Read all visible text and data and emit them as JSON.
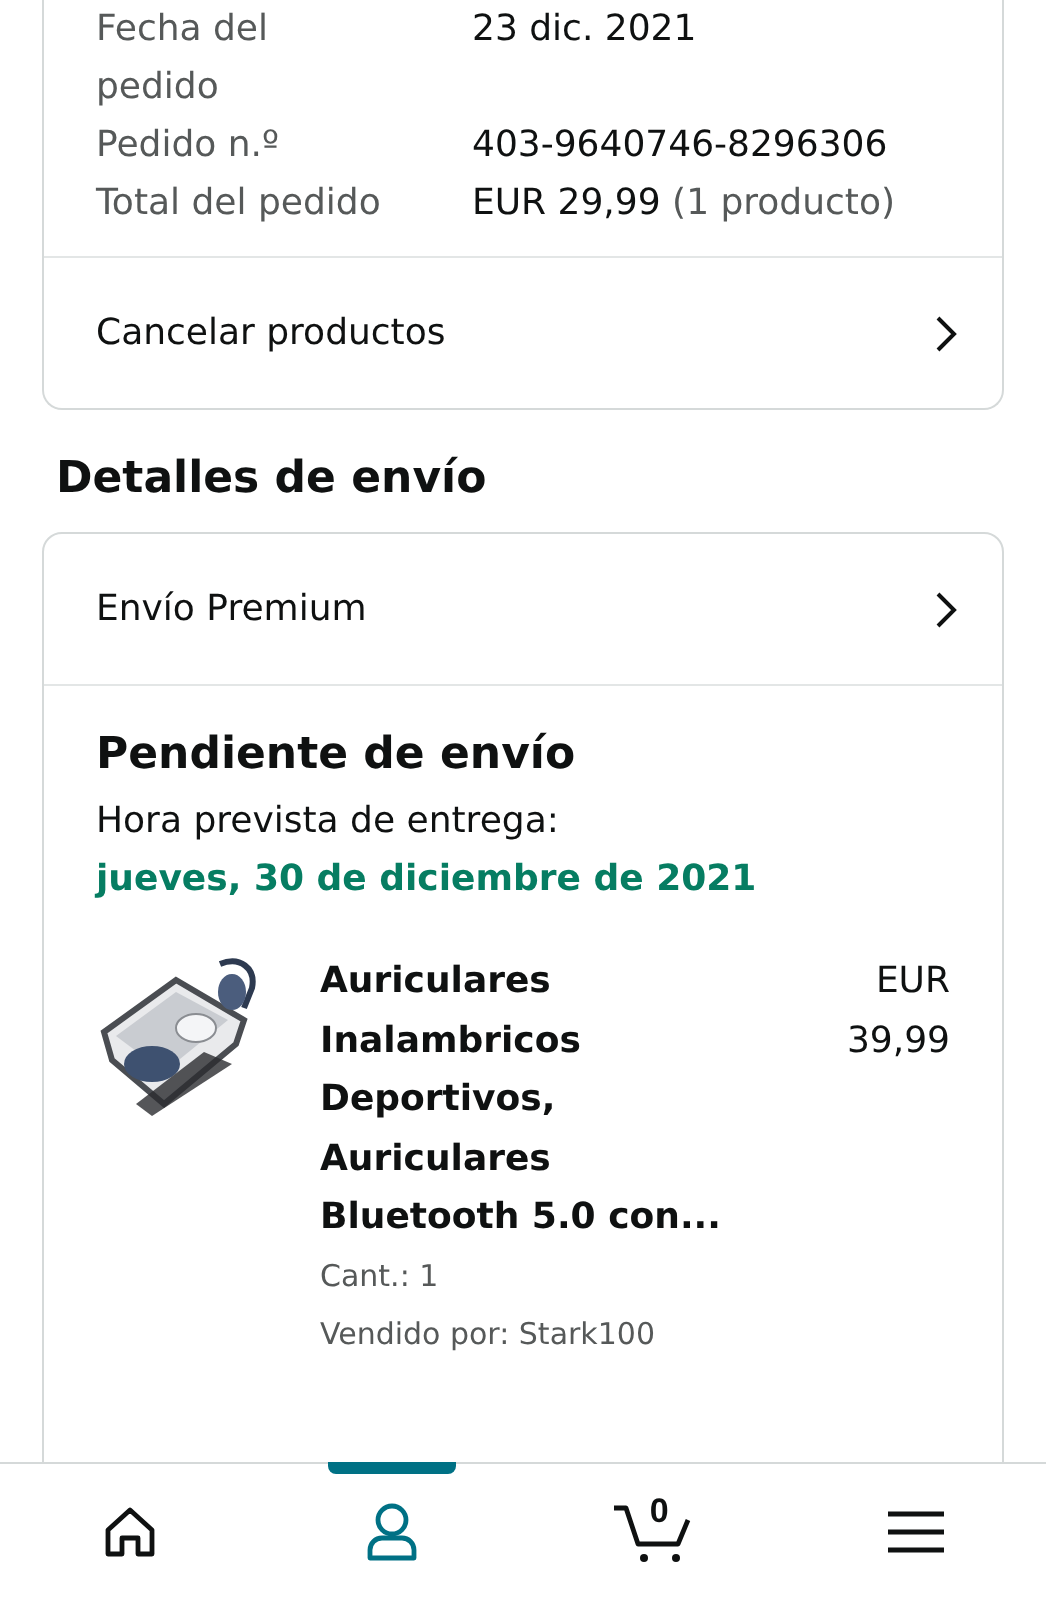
{
  "order_summary": {
    "rows": [
      {
        "label": "Fecha del pedido",
        "value": "23 dic. 2021"
      },
      {
        "label": "Pedido n.º",
        "value": "403-9640746-8296306"
      },
      {
        "label": "Total del pedido",
        "value": "EUR 29,99",
        "note": "(1 producto)"
      }
    ],
    "action": "Cancelar productos"
  },
  "shipping": {
    "heading": "Detalles de envío",
    "method": "Envío Premium",
    "status": "Pendiente de envío",
    "eta_label": "Hora prevista de entrega:",
    "eta": "jueves, 30 de diciembre de 2021",
    "item": {
      "kind": "picture",
      "title": "Auriculares Inalambricos Deportivos, Auriculares Bluetooth 5.0 con...",
      "price": "EUR 39,99",
      "quantity": "Cant.: 1",
      "seller": "Vendido por: Stark100"
    }
  },
  "nav": [
    {
      "kind": "home",
      "selected": false
    },
    {
      "kind": "account",
      "selected": true
    },
    {
      "kind": "cart",
      "count": "0",
      "selected": false
    },
    {
      "kind": "menu",
      "selected": false
    }
  ]
}
